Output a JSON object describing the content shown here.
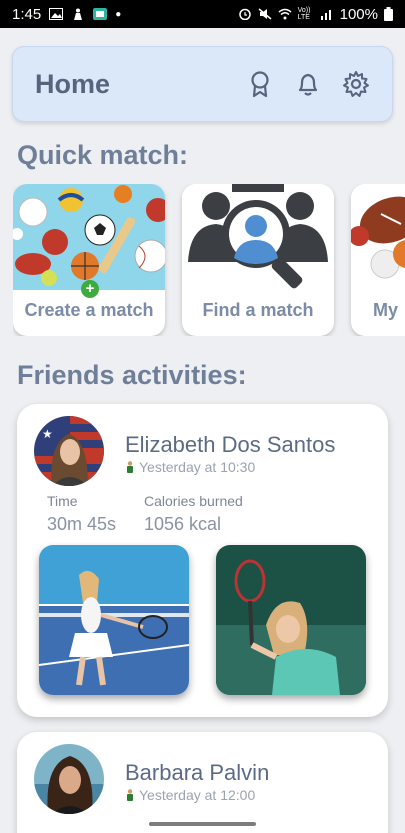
{
  "status_bar": {
    "time": "1:45",
    "battery": "100%",
    "volte_label": "Vo)) LTE"
  },
  "header": {
    "title": "Home",
    "icons": [
      "ribbon-award-icon",
      "bell-icon",
      "gear-icon"
    ]
  },
  "quick_match": {
    "title": "Quick match:",
    "cards": [
      {
        "label": "Create a match",
        "icon": "sports-balls-image"
      },
      {
        "label": "Find a match",
        "icon": "find-people-magnifier-image"
      },
      {
        "label": "My",
        "icon": "sports-balls-image"
      }
    ]
  },
  "friends": {
    "title": "Friends activities:",
    "activities": [
      {
        "name": "Elizabeth Dos Santos",
        "when": "Yesterday at 10:30",
        "time_label": "Time",
        "time_value": "30m 45s",
        "calories_label": "Calories burned",
        "calories_value": "1056 kcal"
      },
      {
        "name": "Barbara Palvin",
        "when": "Yesterday at 12:00"
      }
    ]
  },
  "colors": {
    "header_bg": "#dbe8fa",
    "title_text": "#56657d",
    "section_text": "#6f7f99",
    "page_bg": "#eeeff2"
  }
}
